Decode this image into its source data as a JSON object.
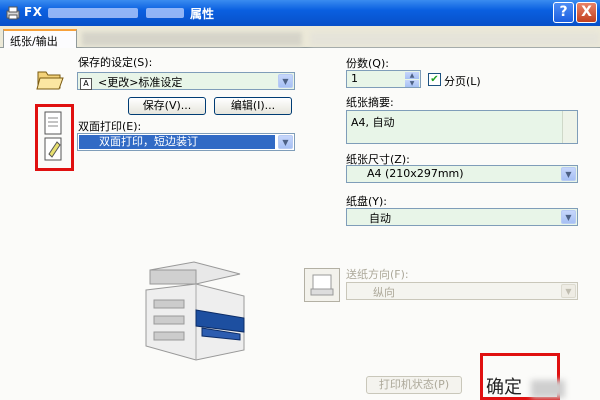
{
  "window": {
    "title_prefix": "FX",
    "title_suffix": "属性",
    "help_label": "?",
    "close_label": "X"
  },
  "tabs": {
    "active_label": "纸张/输出"
  },
  "saved_settings": {
    "label": "保存的设定(S):",
    "value": "<更改>标准设定",
    "save_button": "保存(V)...",
    "edit_button": "编辑(I)..."
  },
  "duplex": {
    "label": "双面打印(E):",
    "value": "双面打印，短边装订"
  },
  "copies": {
    "label": "份数(Q):",
    "value": "1",
    "collate_label": "分页(L)",
    "collate_checked": true
  },
  "paper_summary": {
    "label": "纸张摘要:",
    "value": "A4, 自动"
  },
  "paper_size": {
    "label": "纸张尺寸(Z):",
    "value": "A4 (210x297mm)"
  },
  "paper_tray": {
    "label": "纸盘(Y):",
    "value": "自动"
  },
  "feed_direction": {
    "label": "送纸方向(F):",
    "value": "纵向"
  },
  "footer": {
    "printer_status_button": "打印机状态(P)",
    "ok_button": "确定"
  },
  "colors": {
    "title_bar": "#0a5fe0",
    "selection": "#316ac5",
    "highlight_box": "#e01010",
    "field_bg": "#e8f5e8"
  }
}
